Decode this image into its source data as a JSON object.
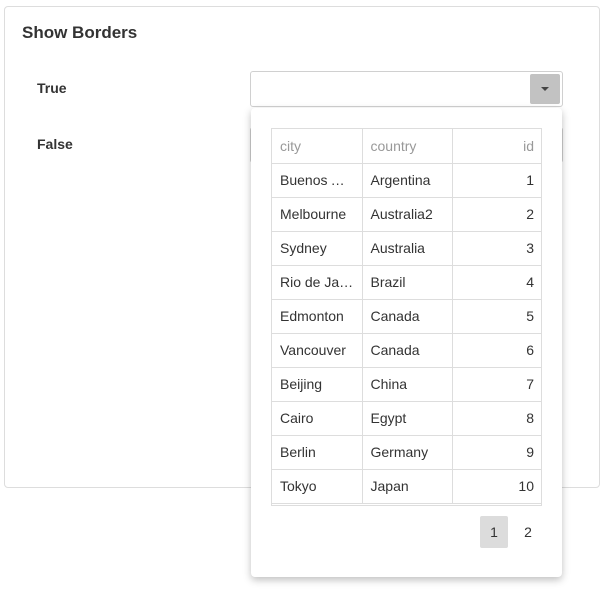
{
  "card": {
    "title": "Show Borders",
    "rows": [
      {
        "label": "True"
      },
      {
        "label": "False"
      }
    ]
  },
  "grid": {
    "columns": [
      "city",
      "country",
      "id"
    ],
    "rows": [
      {
        "city": "Buenos Aires",
        "country": "Argentina",
        "id": "1"
      },
      {
        "city": "Melbourne",
        "country": "Australia2",
        "id": "2"
      },
      {
        "city": "Sydney",
        "country": "Australia",
        "id": "3"
      },
      {
        "city": "Rio de Janeiro",
        "country": "Brazil",
        "id": "4"
      },
      {
        "city": "Edmonton",
        "country": "Canada",
        "id": "5"
      },
      {
        "city": "Vancouver",
        "country": "Canada",
        "id": "6"
      },
      {
        "city": "Beijing",
        "country": "China",
        "id": "7"
      },
      {
        "city": "Cairo",
        "country": "Egypt",
        "id": "8"
      },
      {
        "city": "Berlin",
        "country": "Germany",
        "id": "9"
      },
      {
        "city": "Tokyo",
        "country": "Japan",
        "id": "10"
      }
    ]
  },
  "pager": {
    "pages": [
      "1",
      "2"
    ],
    "active": "1"
  },
  "icons": {
    "dropdown": "caret-down-icon"
  }
}
